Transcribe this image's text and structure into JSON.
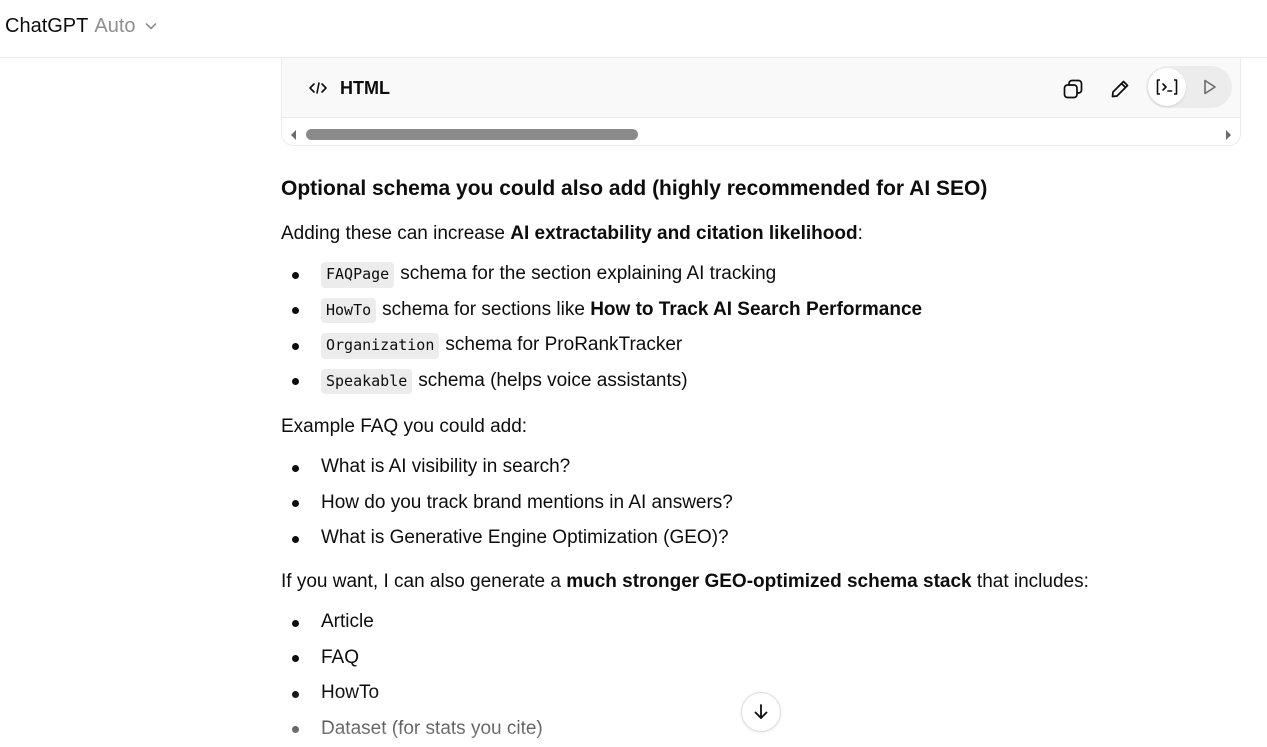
{
  "header": {
    "model_name": "ChatGPT",
    "model_variant": "Auto"
  },
  "code_block": {
    "language": "HTML",
    "icons": [
      "code-icon",
      "copy-icon",
      "edit-icon",
      "code-view-icon",
      "play-icon"
    ],
    "scroll_fraction": 0.35
  },
  "content": {
    "heading": "Optional schema you could also add (highly recommended for AI SEO)",
    "intro_prefix": "Adding these can increase ",
    "intro_bold": "AI extractability and citation likelihood",
    "intro_suffix": ":",
    "schema_items": [
      {
        "code": "FAQPage",
        "text": "schema for the section explaining AI tracking",
        "bold": ""
      },
      {
        "code": "HowTo",
        "text": "schema for sections like ",
        "bold": "How to Track AI Search Performance"
      },
      {
        "code": "Organization",
        "text": "schema for ProRankTracker",
        "bold": ""
      },
      {
        "code": "Speakable",
        "text": "schema (helps voice assistants)",
        "bold": ""
      }
    ],
    "faq_intro": "Example FAQ you could add:",
    "faq_items": [
      "What is AI visibility in search?",
      "How do you track brand mentions in AI answers?",
      "What is Generative Engine Optimization (GEO)?"
    ],
    "offer_prefix": "If you want, I can also generate a ",
    "offer_bold": "much stronger GEO-optimized schema stack",
    "offer_suffix": " that includes:",
    "stack_items": [
      "Article",
      "FAQ",
      "HowTo",
      "Dataset (for stats you cite)"
    ]
  },
  "scroll_down_icon": "arrow-down-icon"
}
